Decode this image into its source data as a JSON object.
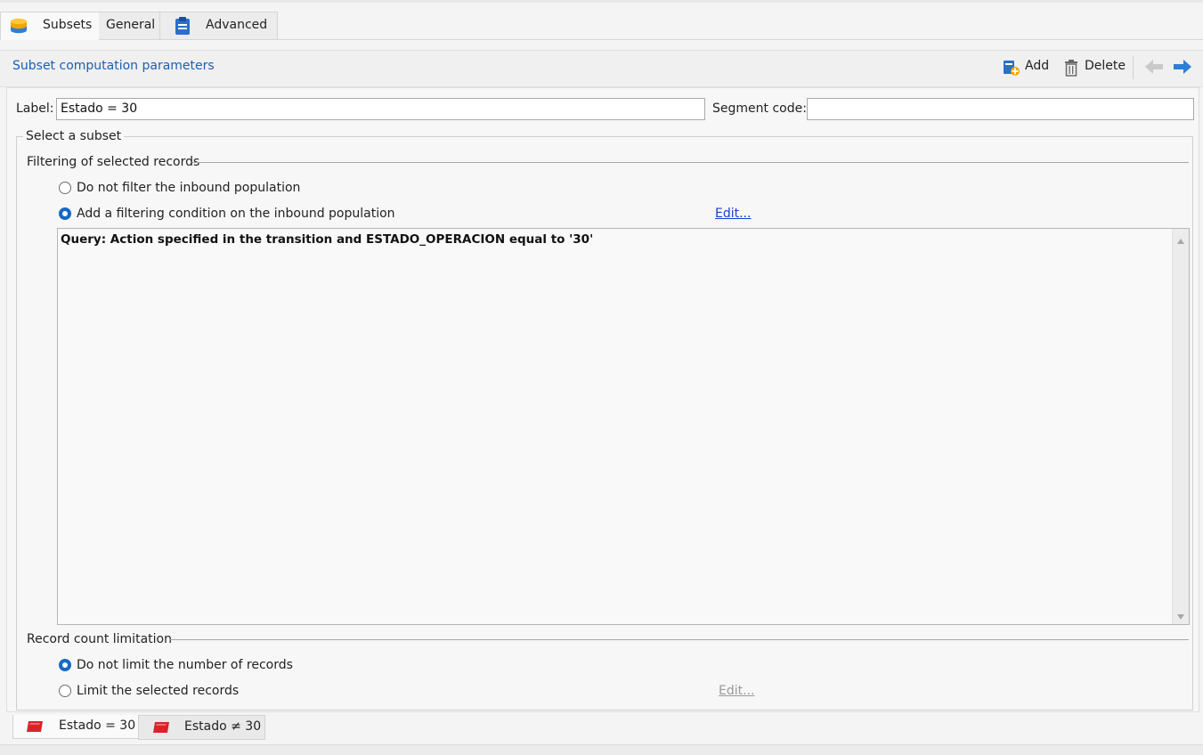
{
  "top_tabs": [
    {
      "label": "Subsets",
      "icon": "database-stack-icon"
    },
    {
      "label": "General"
    },
    {
      "label": "Advanced",
      "icon": "clipboard-icon"
    }
  ],
  "header": {
    "title": "Subset computation parameters",
    "add_label": "Add",
    "delete_label": "Delete"
  },
  "form": {
    "label_caption": "Label:",
    "label_value": "Estado = 30",
    "segment_caption": "Segment code:",
    "segment_value": ""
  },
  "select_subset": {
    "title": "Select a subset",
    "filtering_title": "Filtering of selected records",
    "option_no_filter": "Do not filter the inbound population",
    "option_add_filter": "Add a filtering condition on the inbound population",
    "edit_link": "Edit...",
    "query_text": "Query: Action specified in the transition and ESTADO_OPERACION equal to '30'",
    "limit_title": "Record count limitation",
    "option_no_limit": "Do not limit the number of records",
    "option_limit": "Limit the selected records",
    "limit_edit_link": "Edit..."
  },
  "bottom_tabs": [
    {
      "label": "Estado = 30",
      "icon": "segment-icon"
    },
    {
      "label": "Estado ≠ 30",
      "icon": "segment-icon"
    }
  ],
  "colors": {
    "accent": "#1a5fb4",
    "radio_selected": "#1769c4",
    "link": "#1a3fcc",
    "segment_icon": "#d8232a"
  }
}
